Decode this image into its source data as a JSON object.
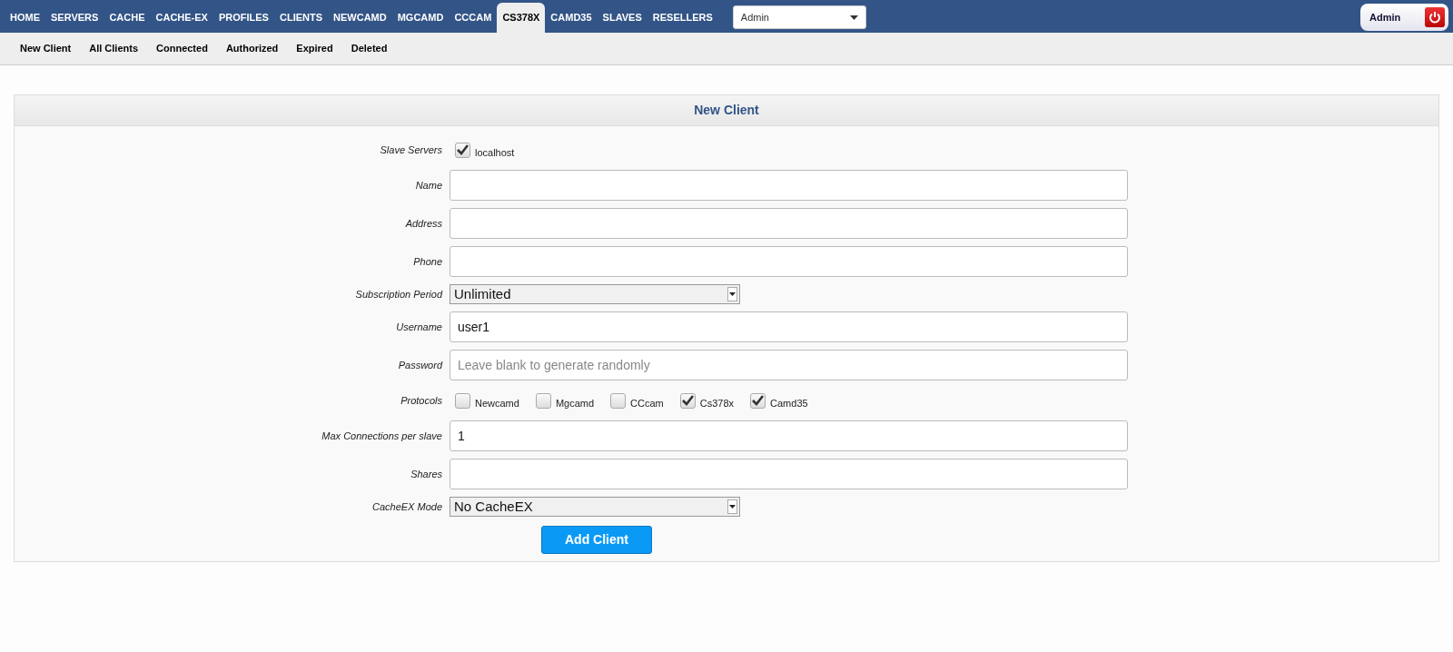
{
  "nav": {
    "tabs": [
      {
        "label": "HOME",
        "selected": false
      },
      {
        "label": "SERVERS",
        "selected": false
      },
      {
        "label": "CACHE",
        "selected": false
      },
      {
        "label": "CACHE-EX",
        "selected": false
      },
      {
        "label": "PROFILES",
        "selected": false
      },
      {
        "label": "CLIENTS",
        "selected": false
      },
      {
        "label": "NEWCAMD",
        "selected": false
      },
      {
        "label": "MGCAMD",
        "selected": false
      },
      {
        "label": "CCCAM",
        "selected": false
      },
      {
        "label": "CS378X",
        "selected": true
      },
      {
        "label": "CAMD35",
        "selected": false
      },
      {
        "label": "SLAVES",
        "selected": false
      },
      {
        "label": "RESELLERS",
        "selected": false
      }
    ],
    "dropdown": {
      "value": "Admin"
    },
    "user": {
      "name": "Admin"
    }
  },
  "subnav": [
    "New Client",
    "All Clients",
    "Connected",
    "Authorized",
    "Expired",
    "Deleted"
  ],
  "panel": {
    "title": "New Client",
    "rows": [
      {
        "kind": "checks",
        "label": "Slave Servers",
        "options": [
          {
            "label": "localhost",
            "checked": true
          }
        ]
      },
      {
        "kind": "text",
        "label": "Name"
      },
      {
        "kind": "text",
        "label": "Address"
      },
      {
        "kind": "text",
        "label": "Phone"
      },
      {
        "kind": "select",
        "label": "Subscription Period",
        "value": "Unlimited"
      },
      {
        "kind": "text",
        "label": "Username",
        "value": "user1"
      },
      {
        "kind": "text",
        "label": "Password",
        "placeholder": "Leave blank to generate randomly"
      },
      {
        "kind": "checks",
        "label": "Protocols",
        "options": [
          {
            "label": "Newcamd",
            "checked": false
          },
          {
            "label": "Mgcamd",
            "checked": false
          },
          {
            "label": "CCcam",
            "checked": false
          },
          {
            "label": "Cs378x",
            "checked": true
          },
          {
            "label": "Camd35",
            "checked": true
          }
        ]
      },
      {
        "kind": "text",
        "label": "Max Connections per slave",
        "value": "1"
      },
      {
        "kind": "text",
        "label": "Shares"
      },
      {
        "kind": "select",
        "label": "CacheEX Mode",
        "value": "No CacheEX"
      }
    ],
    "button": "Add Client"
  }
}
